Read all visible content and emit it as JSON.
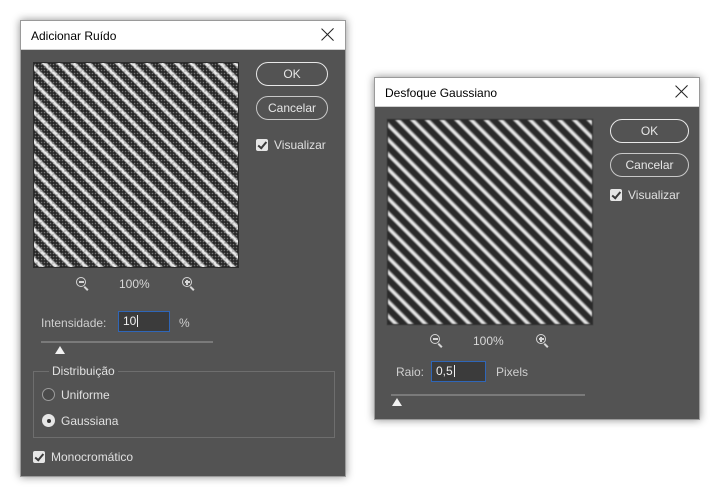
{
  "add_noise": {
    "title": "Adicionar Ruído",
    "zoom_label": "100%",
    "ok_label": "OK",
    "cancel_label": "Cancelar",
    "preview_label": "Visualizar",
    "preview_checked": true,
    "amount_label": "Intensidade:",
    "amount_value": "10",
    "amount_unit": "%",
    "distribution_label": "Distribuição",
    "uniform_label": "Uniforme",
    "gaussian_label": "Gaussiana",
    "selected_distribution": "Gaussiana",
    "monochromatic_label": "Monocromático",
    "monochromatic_checked": true
  },
  "gaussian_blur": {
    "title": "Desfoque Gaussiano",
    "zoom_label": "100%",
    "ok_label": "OK",
    "cancel_label": "Cancelar",
    "preview_label": "Visualizar",
    "preview_checked": true,
    "radius_label": "Raio:",
    "radius_value": "0,5",
    "radius_unit": "Pixels"
  },
  "icons": {
    "zoom_out": "zoom-out-icon",
    "zoom_in": "zoom-in-icon",
    "close": "close-icon",
    "checkbox": "checkmark-icon"
  },
  "colors": {
    "dialog_bg": "#535353",
    "input_border": "#2f66b8"
  }
}
